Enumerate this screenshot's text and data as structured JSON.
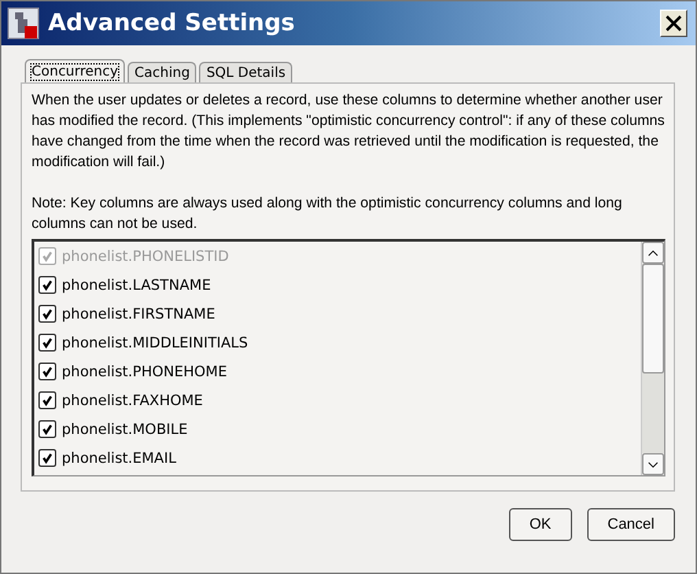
{
  "window": {
    "title": "Advanced Settings"
  },
  "tabs": [
    {
      "label": "Concurrency",
      "selected": true
    },
    {
      "label": "Caching",
      "selected": false
    },
    {
      "label": "SQL Details",
      "selected": false
    }
  ],
  "description": "When the user updates or deletes a record, use these columns to determine whether another user has modified the record. (This implements \"optimistic concurrency control\": if any of these columns have changed from the time when the record was retrieved until the modification is requested, the modification will fail.)",
  "note": " Note:  Key columns are always used along with the optimistic concurrency columns and long columns can not be used.",
  "columns": [
    {
      "label": "phonelist.PHONELISTID",
      "checked": true,
      "disabled": true
    },
    {
      "label": "phonelist.LASTNAME",
      "checked": true,
      "disabled": false
    },
    {
      "label": "phonelist.FIRSTNAME",
      "checked": true,
      "disabled": false
    },
    {
      "label": "phonelist.MIDDLEINITIALS",
      "checked": true,
      "disabled": false
    },
    {
      "label": "phonelist.PHONEHOME",
      "checked": true,
      "disabled": false
    },
    {
      "label": "phonelist.FAXHOME",
      "checked": true,
      "disabled": false
    },
    {
      "label": "phonelist.MOBILE",
      "checked": true,
      "disabled": false
    },
    {
      "label": "phonelist.EMAIL",
      "checked": true,
      "disabled": false
    }
  ],
  "buttons": [
    "OK",
    "Cancel"
  ]
}
